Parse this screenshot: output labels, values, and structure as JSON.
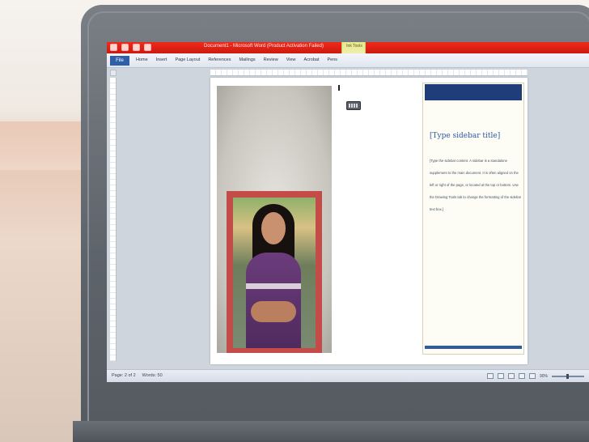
{
  "window": {
    "title": "Document1 - Microsoft Word (Product Activation Failed)",
    "contextual_group": "Ink Tools"
  },
  "ribbon": {
    "file_tab": "File",
    "tabs": [
      "Home",
      "Insert",
      "Page Layout",
      "References",
      "Mailings",
      "Review",
      "View",
      "Acrobat",
      "Pens"
    ]
  },
  "document": {
    "sidebar": {
      "title": "[Type sidebar title]",
      "body": "[Type the sidebar content. A sidebar is a standalone supplement to the main document. It is often aligned on the left or right of the page, or located at the top or bottom. Use the Drawing Tools tab to change the formatting of the sidebar text box.]"
    }
  },
  "status": {
    "page": "Page: 2 of 2",
    "words": "Words: 50",
    "zoom": "90%"
  },
  "colors": {
    "titlebar": "#e0241a",
    "sidebar_bar": "#1f3d78",
    "photo_frame": "#c34b48"
  }
}
